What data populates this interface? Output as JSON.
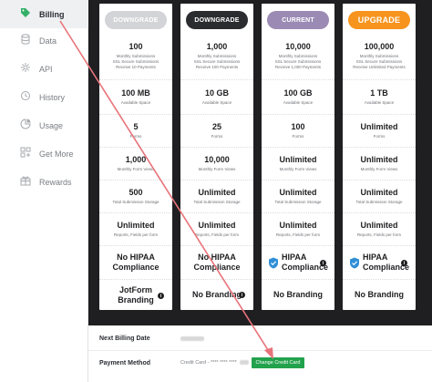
{
  "sidebar": {
    "items": [
      {
        "label": "Billing",
        "icon": "tag-icon",
        "active": true
      },
      {
        "label": "Data",
        "icon": "database-icon"
      },
      {
        "label": "API",
        "icon": "api-icon"
      },
      {
        "label": "History",
        "icon": "history-icon"
      },
      {
        "label": "Usage",
        "icon": "usage-icon"
      },
      {
        "label": "Get More",
        "icon": "get-more-icon"
      },
      {
        "label": "Rewards",
        "icon": "rewards-icon"
      }
    ]
  },
  "plans": [
    {
      "button": "DOWNGRADE",
      "button_color": "#d3d4d7",
      "submissions": {
        "value": "100",
        "lines": [
          "Monthly Submissions",
          "SSL Secure Submissions",
          "Receive 10 Payments"
        ]
      },
      "space": {
        "value": "100 MB",
        "label": "Available Space"
      },
      "forms": {
        "value": "5",
        "label": "Forms"
      },
      "views": {
        "value": "1,000",
        "label": "Monthly Form Views"
      },
      "storage": {
        "value": "500",
        "label": "Total Submission Storage"
      },
      "reports": {
        "value": "Unlimited",
        "label": "Reports, Fields per form"
      },
      "hipaa": {
        "line1": "No HIPAA",
        "line2": "Compliance",
        "has_icon": false
      },
      "branding": {
        "line1": "JotForm",
        "line2": "Branding",
        "info": true
      }
    },
    {
      "button": "DOWNGRADE",
      "button_color": "#2b2c30",
      "submissions": {
        "value": "1,000",
        "lines": [
          "Monthly Submissions",
          "SSL Secure Submissions",
          "Receive 100 Payments"
        ]
      },
      "space": {
        "value": "10 GB",
        "label": "Available Space"
      },
      "forms": {
        "value": "25",
        "label": "Forms"
      },
      "views": {
        "value": "10,000",
        "label": "Monthly Form Views"
      },
      "storage": {
        "value": "Unlimited",
        "label": "Total Submission Storage"
      },
      "reports": {
        "value": "Unlimited",
        "label": "Reports, Fields per form"
      },
      "hipaa": {
        "line1": "No HIPAA",
        "line2": "Compliance",
        "has_icon": false
      },
      "branding": {
        "line1": "No Branding",
        "line2": "",
        "info": true
      }
    },
    {
      "button": "CURRENT",
      "button_color": "#9b8bb4",
      "submissions": {
        "value": "10,000",
        "lines": [
          "Monthly Submissions",
          "SSL Secure Submissions",
          "Receive 1,000 Payments"
        ]
      },
      "space": {
        "value": "100 GB",
        "label": "Available Space"
      },
      "forms": {
        "value": "100",
        "label": "Forms"
      },
      "views": {
        "value": "Unlimited",
        "label": "Monthly Form Views"
      },
      "storage": {
        "value": "Unlimited",
        "label": "Total Submission Storage"
      },
      "reports": {
        "value": "Unlimited",
        "label": "Reports, Fields per form"
      },
      "hipaa": {
        "line1": "HIPAA",
        "line2": "Compliance",
        "has_icon": true
      },
      "branding": {
        "line1": "No Branding",
        "line2": "",
        "info": false
      }
    },
    {
      "button": "UPGRADE",
      "button_color": "#f7941d",
      "submissions": {
        "value": "100,000",
        "lines": [
          "Monthly Submissions",
          "SSL Secure Submissions",
          "Receive Unlimited Payments"
        ]
      },
      "space": {
        "value": "1 TB",
        "label": "Available Space"
      },
      "forms": {
        "value": "Unlimited",
        "label": "Forms"
      },
      "views": {
        "value": "Unlimited",
        "label": "Monthly Form Views"
      },
      "storage": {
        "value": "Unlimited",
        "label": "Total Submission Storage"
      },
      "reports": {
        "value": "Unlimited",
        "label": "Reports, Fields per form"
      },
      "hipaa": {
        "line1": "HIPAA",
        "line2": "Compliance",
        "has_icon": true
      },
      "branding": {
        "line1": "No Branding",
        "line2": "",
        "info": false
      }
    }
  ],
  "billing": {
    "next_label": "Next Billing Date",
    "payment_label": "Payment Method",
    "card_text": "Credit Card - **** **** ****",
    "change_button": "Change Credit Card"
  },
  "colors": {
    "accent_green": "#23a24d",
    "arrow": "#e8737a",
    "dark_bg": "#1f1f22"
  }
}
